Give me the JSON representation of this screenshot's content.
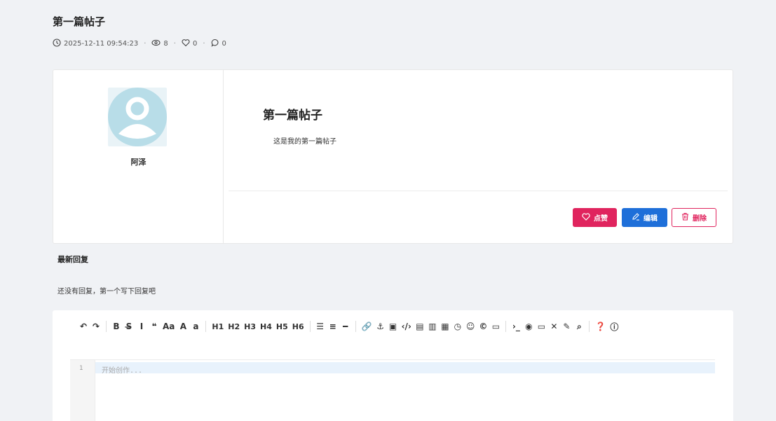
{
  "post": {
    "title": "第一篇帖子",
    "datetime": "2025-12-11 09:54:23",
    "views": "8",
    "likes": "0",
    "comments": "0",
    "heading": "第一篇帖子",
    "body": "这是我的第一篇帖子"
  },
  "author": {
    "name": "阿泽"
  },
  "actions": {
    "like_label": "点赞",
    "edit_label": "编辑",
    "delete_label": "删除"
  },
  "replies": {
    "title": "最新回复",
    "empty_text": "还没有回复，第一个写下回复吧"
  },
  "editor": {
    "line_number": "1",
    "placeholder": "开始创作...",
    "toolbar": [
      {
        "name": "undo-icon",
        "glyph": "↶"
      },
      {
        "name": "redo-icon",
        "glyph": "↷"
      },
      {
        "sep": true
      },
      {
        "name": "bold-button",
        "glyph": "B"
      },
      {
        "name": "strikethrough-button",
        "glyph": "S̶"
      },
      {
        "name": "italic-button",
        "glyph": "I"
      },
      {
        "name": "quote-button",
        "glyph": "❝"
      },
      {
        "name": "upper-lower-case-button",
        "glyph": "Aa"
      },
      {
        "name": "uppercase-button",
        "glyph": "A"
      },
      {
        "name": "lowercase-button",
        "glyph": "a"
      },
      {
        "sep": true
      },
      {
        "name": "h1-button",
        "glyph": "H1"
      },
      {
        "name": "h2-button",
        "glyph": "H2"
      },
      {
        "name": "h3-button",
        "glyph": "H3"
      },
      {
        "name": "h4-button",
        "glyph": "H4"
      },
      {
        "name": "h5-button",
        "glyph": "H5"
      },
      {
        "name": "h6-button",
        "glyph": "H6"
      },
      {
        "sep": true
      },
      {
        "name": "unordered-list-icon",
        "glyph": "☰"
      },
      {
        "name": "ordered-list-icon",
        "glyph": "≡"
      },
      {
        "name": "horizontal-rule-icon",
        "glyph": "━"
      },
      {
        "sep": true
      },
      {
        "name": "link-icon",
        "glyph": "🔗"
      },
      {
        "name": "anchor-icon",
        "glyph": "⚓"
      },
      {
        "name": "image-icon",
        "glyph": "▣"
      },
      {
        "name": "code-icon",
        "glyph": "‹/›"
      },
      {
        "name": "code-block-icon",
        "glyph": "▤"
      },
      {
        "name": "code-file-icon",
        "glyph": "▥"
      },
      {
        "name": "table-icon",
        "glyph": "▦"
      },
      {
        "name": "datetime-icon",
        "glyph": "◷"
      },
      {
        "name": "emoji-icon",
        "glyph": "☺"
      },
      {
        "name": "html-entities-icon",
        "glyph": "©"
      },
      {
        "name": "pagebreak-icon",
        "glyph": "▭"
      },
      {
        "sep": true
      },
      {
        "name": "goto-line-icon",
        "glyph": "›_"
      },
      {
        "name": "preview-icon",
        "glyph": "◉"
      },
      {
        "name": "watch-icon",
        "glyph": "▭"
      },
      {
        "name": "fullscreen-icon",
        "glyph": "✕"
      },
      {
        "name": "clear-icon",
        "glyph": "✎"
      },
      {
        "name": "search-icon",
        "glyph": "⌕"
      },
      {
        "sep": true
      },
      {
        "name": "help-icon",
        "glyph": "❓"
      },
      {
        "name": "info-icon",
        "glyph": "ⓘ"
      }
    ]
  },
  "colors": {
    "like": "#e0245e",
    "edit": "#1e6fd9",
    "avatar_bg": "#b8dde8"
  }
}
